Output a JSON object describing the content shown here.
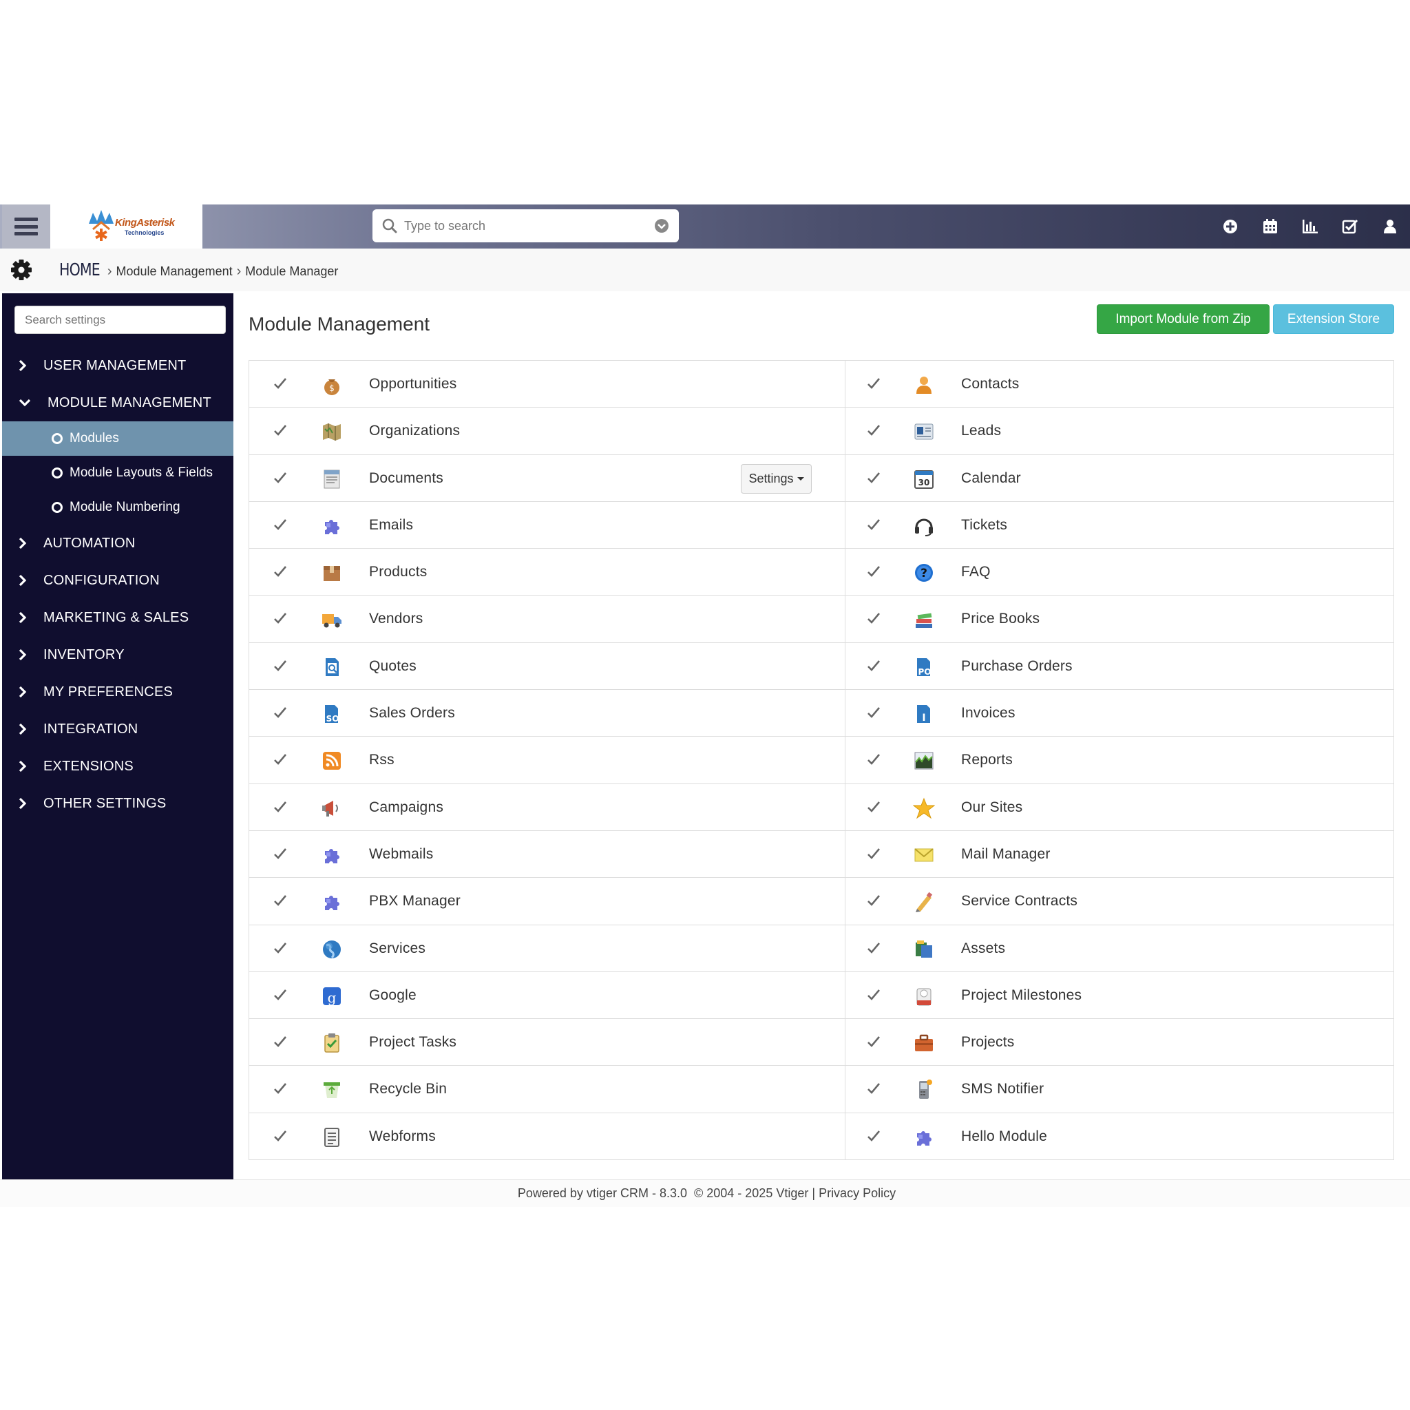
{
  "topbar": {
    "logo_text": "KingAsterisk",
    "logo_sub": "Technologies",
    "search_placeholder": "Type to search"
  },
  "breadcrumb": {
    "home": "HOME",
    "level1": "Module Management",
    "level2": "Module Manager"
  },
  "sidebar": {
    "search_placeholder": "Search settings",
    "items": [
      {
        "label": "USER MANAGEMENT"
      },
      {
        "label": "MODULE MANAGEMENT"
      },
      {
        "label": "AUTOMATION"
      },
      {
        "label": "CONFIGURATION"
      },
      {
        "label": "MARKETING & SALES"
      },
      {
        "label": "INVENTORY"
      },
      {
        "label": "MY PREFERENCES"
      },
      {
        "label": "INTEGRATION"
      },
      {
        "label": "EXTENSIONS"
      },
      {
        "label": "OTHER SETTINGS"
      }
    ],
    "sub_items": [
      {
        "label": "Modules"
      },
      {
        "label": "Module Layouts & Fields"
      },
      {
        "label": "Module Numbering"
      }
    ]
  },
  "main": {
    "title": "Module Management",
    "import_button": "Import Module from Zip",
    "store_button": "Extension Store",
    "settings_button": "Settings",
    "left_modules": [
      {
        "name": "Opportunities",
        "icon": "money-bag-icon"
      },
      {
        "name": "Organizations",
        "icon": "map-icon"
      },
      {
        "name": "Documents",
        "icon": "document-icon"
      },
      {
        "name": "Emails",
        "icon": "puzzle-icon"
      },
      {
        "name": "Products",
        "icon": "box-icon"
      },
      {
        "name": "Vendors",
        "icon": "truck-icon"
      },
      {
        "name": "Quotes",
        "icon": "quote-doc-icon"
      },
      {
        "name": "Sales Orders",
        "icon": "sales-order-icon"
      },
      {
        "name": "Rss",
        "icon": "rss-icon"
      },
      {
        "name": "Campaigns",
        "icon": "megaphone-icon"
      },
      {
        "name": "Webmails",
        "icon": "puzzle-icon"
      },
      {
        "name": "PBX Manager",
        "icon": "puzzle-icon"
      },
      {
        "name": "Services",
        "icon": "globe-icon"
      },
      {
        "name": "Google",
        "icon": "google-icon"
      },
      {
        "name": "Project Tasks",
        "icon": "clipboard-check-icon"
      },
      {
        "name": "Recycle Bin",
        "icon": "recycle-bin-icon"
      },
      {
        "name": "Webforms",
        "icon": "form-icon"
      }
    ],
    "right_modules": [
      {
        "name": "Contacts",
        "icon": "person-icon"
      },
      {
        "name": "Leads",
        "icon": "id-card-icon"
      },
      {
        "name": "Calendar",
        "icon": "calendar-icon"
      },
      {
        "name": "Tickets",
        "icon": "headset-icon"
      },
      {
        "name": "FAQ",
        "icon": "question-icon"
      },
      {
        "name": "Price Books",
        "icon": "books-icon"
      },
      {
        "name": "Purchase Orders",
        "icon": "purchase-order-icon"
      },
      {
        "name": "Invoices",
        "icon": "invoice-icon"
      },
      {
        "name": "Reports",
        "icon": "chart-icon"
      },
      {
        "name": "Our Sites",
        "icon": "star-icon"
      },
      {
        "name": "Mail Manager",
        "icon": "envelope-icon"
      },
      {
        "name": "Service Contracts",
        "icon": "pencil-icon"
      },
      {
        "name": "Assets",
        "icon": "assets-icon"
      },
      {
        "name": "Project Milestones",
        "icon": "milestone-icon"
      },
      {
        "name": "Projects",
        "icon": "briefcase-icon"
      },
      {
        "name": "SMS Notifier",
        "icon": "phone-icon"
      },
      {
        "name": "Hello Module",
        "icon": "puzzle-icon"
      }
    ]
  },
  "footer": {
    "powered": "Powered by vtiger CRM - 8.3.0",
    "copyright": "© 2004 - 2025",
    "vtiger": "Vtiger",
    "divider": "|",
    "privacy": "Privacy Policy"
  },
  "colors": {
    "sidebar_bg": "#100e2f",
    "active_sub": "#6f93ad",
    "import_green": "#35a645",
    "store_blue": "#5bc0de"
  }
}
